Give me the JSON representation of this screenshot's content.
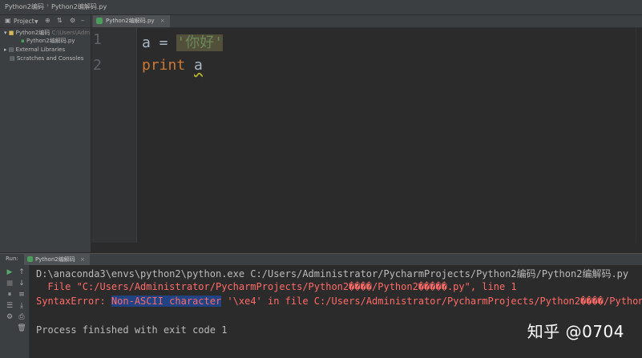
{
  "breadcrumb": {
    "project": "Python2编码",
    "file": "Python2编解码.py"
  },
  "project_panel": {
    "label": "Project",
    "dropdown_icon": "chevron-down-icon",
    "tree": {
      "root_label": "Python2编码",
      "root_path": "C:\\Users\\Adm",
      "file_label": "Python2编解码.py",
      "external_libraries": "External Libraries",
      "scratches": "Scratches and Consoles"
    }
  },
  "editor": {
    "tab_label": "Python2编解码.py",
    "tab_close": "×",
    "lines": [
      {
        "number": "1",
        "var": "a",
        "op": " = ",
        "string": "'你好'"
      },
      {
        "number": "2",
        "keyword": "print",
        "arg": "a"
      }
    ]
  },
  "run_panel": {
    "label": "Run:",
    "tab_label": "Python2编解码",
    "tab_close": "×",
    "console": {
      "line1": "D:\\anaconda3\\envs\\python2\\python.exe C:/Users/Administrator/PycharmProjects/Python2编码/Python2编解码.py",
      "line2": "  File \"C:/Users/Administrator/PycharmProjects/Python2����/Python2�����.py\", line 1",
      "line3_prefix": "SyntaxError: ",
      "line3_selected": "Non-ASCII character",
      "line3_suffix": " '\\xe4' in file C:/Users/Administrator/PycharmProjects/Python2����/Python",
      "line5": "Process finished with exit code 1"
    }
  },
  "watermark": "知乎 @0704",
  "colors": {
    "background": "#2b2b2b",
    "keyword": "#cc7832",
    "string": "#6a8759",
    "error": "#ff6b68",
    "selection": "#214283"
  }
}
